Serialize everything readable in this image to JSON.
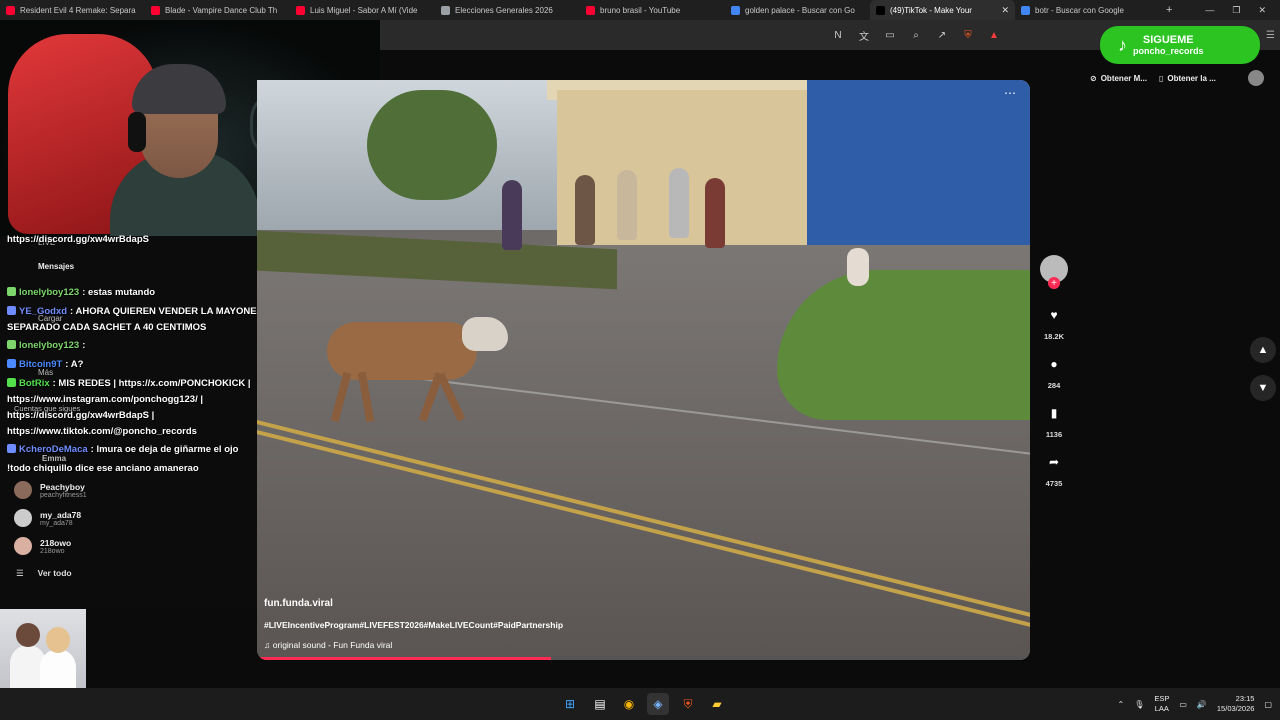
{
  "tabs": [
    {
      "title": "Resident Evil 4 Remake: Separa",
      "icon_color": "#ff0033",
      "active": false
    },
    {
      "title": "Blade - Vampire Dance Club Th",
      "icon_color": "#ff0033",
      "active": false
    },
    {
      "title": "Luis Miguel - Sabor A Mí (Vide",
      "icon_color": "#ff0033",
      "active": false
    },
    {
      "title": "Elecciones Generales 2026",
      "icon_color": "#9aa0a6",
      "active": false
    },
    {
      "title": "bruno brasil - YouTube",
      "icon_color": "#ff0033",
      "active": false
    },
    {
      "title": "golden palace - Buscar con Go",
      "icon_color": "#4285f4",
      "active": false
    },
    {
      "title": "(49)TikTok - Make Your",
      "icon_color": "#000000",
      "active": true
    },
    {
      "title": "botr - Buscar con Google",
      "icon_color": "#4285f4",
      "active": false
    }
  ],
  "chat": [
    {
      "user": "",
      "text": "https://discord.gg/xw4wrBdapS",
      "color": "#ffffff",
      "top": 0
    },
    {
      "user": "",
      "text": "",
      "color": "#ffffff"
    },
    {
      "user": "lonelyboy123",
      "text": ": estas mutando",
      "color": "#7cd66b"
    },
    {
      "user": "YE_Godxd",
      "text": ": AHORA QUIEREN VENDER LA MAYONESA POR",
      "color": "#6f8cff"
    },
    {
      "user": "",
      "text": "SEPARADO CADA SACHET A 40 CENTIMOS",
      "color": "#ffffff"
    },
    {
      "user": "lonelyboy123",
      "text": ":",
      "color": "#7cd66b"
    },
    {
      "user": "Bitcoin9T",
      "text": ": A?",
      "color": "#4b8bff"
    },
    {
      "user": "BotRix",
      "text": ": MIS REDES | https://x.com/PONCHOKICK |",
      "color": "#53e04b"
    },
    {
      "user": "",
      "text": "https://www.instagram.com/ponchogg123/ |",
      "color": "#ffffff"
    },
    {
      "user": "",
      "text": "https://discord.gg/xw4wrBdapS |",
      "color": "#ffffff"
    },
    {
      "user": "",
      "text": "https://www.tiktok.com/@poncho_records",
      "color": "#ffffff"
    },
    {
      "user": "KcheroDeMaca",
      "text": ": lmura oe deja de giñarme el ojo",
      "color": "#6f8cff"
    },
    {
      "user": "",
      "text": "!todo chiquillo dice ese anciano amanerao",
      "color": "#ffffff"
    }
  ],
  "sidebar_ghost": {
    "live": "LIVE",
    "messages": "Mensajes",
    "upload": "Cargar",
    "more": "Más",
    "following": "Cuentas que sigues",
    "emma": "Emma"
  },
  "following_accounts": [
    {
      "name": "Peachyboy",
      "handle": "peachyfitness1"
    },
    {
      "name": "my_ada78",
      "handle": "my_ada78"
    },
    {
      "name": "218owo",
      "handle": "218owo"
    }
  ],
  "see_all": "Ver todo",
  "video": {
    "username": "fun.funda.viral",
    "hashtags": "#LIVEIncentiveProgram#LIVEFEST2026#MakeLIVECount#PaidPartnership",
    "sound": "original sound - Fun Funda viral",
    "progress": 0.38
  },
  "actions": {
    "likes": "18.2K",
    "comments": "284",
    "saves": "1136",
    "shares": "4735"
  },
  "promo": {
    "title": "SIGUEME",
    "handle": "poncho_records"
  },
  "top_buttons": {
    "b1": "Obtener M...",
    "b2": "Obtener la ..."
  },
  "tray": {
    "lang1": "ESP",
    "lang2": "LAA",
    "time": "23:15",
    "date": "15/03/2026"
  },
  "colors": {
    "tiktok_red": "#fe2c55",
    "promo_green": "#2bc421"
  }
}
